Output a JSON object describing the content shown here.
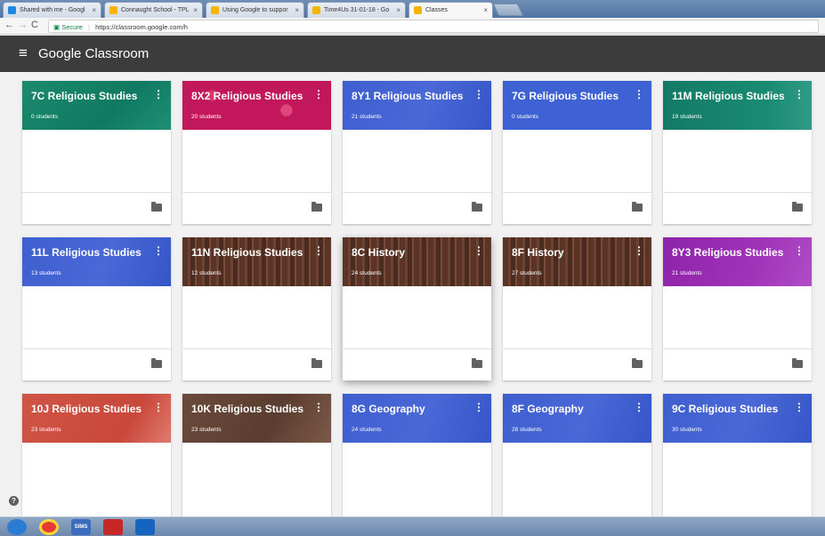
{
  "browser": {
    "tabs": [
      {
        "label": "Shared with me - Googl",
        "color": "#1e88e5"
      },
      {
        "label": "Connaught School - TPL",
        "color": "#f4b400"
      },
      {
        "label": "Using Google to suppor",
        "color": "#f4b400"
      },
      {
        "label": "Time4Us 31-01-18 - Go",
        "color": "#f4b400"
      },
      {
        "label": "Classes",
        "color": "#f4b400"
      }
    ],
    "secure_label": "Secure",
    "url": "https://classroom.google.com/h"
  },
  "app": {
    "brand": "Google",
    "name": "Classroom"
  },
  "classes": [
    {
      "title": "7C Religious Studies",
      "students": "0 students",
      "theme": "bg-teal"
    },
    {
      "title": "8X2 Religious Studies",
      "students": "20 students",
      "theme": "bg-pink"
    },
    {
      "title": "8Y1 Religious Studies",
      "students": "21 students",
      "theme": "bg-blue"
    },
    {
      "title": "7G Religious Studies",
      "students": "0 students",
      "theme": "bg-blue2"
    },
    {
      "title": "11M Religious Studies",
      "students": "19 students",
      "theme": "bg-teal2"
    },
    {
      "title": "11L Religious Studies",
      "students": "13 students",
      "theme": "bg-blue"
    },
    {
      "title": "11N Religious Studies",
      "students": "12 students",
      "theme": "bg-brown"
    },
    {
      "title": "8C History",
      "students": "24 students",
      "theme": "bg-brown"
    },
    {
      "title": "8F History",
      "students": "27 students",
      "theme": "bg-brown"
    },
    {
      "title": "8Y3 Religious Studies",
      "students": "21 students",
      "theme": "bg-purple"
    },
    {
      "title": "10J Religious Studies",
      "students": "23 students",
      "theme": "bg-red"
    },
    {
      "title": "10K Religious Studies",
      "students": "23 students",
      "theme": "bg-brown2"
    },
    {
      "title": "8G Geography",
      "students": "24 students",
      "theme": "bg-blue"
    },
    {
      "title": "8F Geography",
      "students": "28 students",
      "theme": "bg-blue"
    },
    {
      "title": "9C Religious Studies",
      "students": "30 students",
      "theme": "bg-blue"
    }
  ],
  "help_icon": "?",
  "taskbar": {
    "items": [
      {
        "icon": "windows-start-icon",
        "color": "#2b7cd3"
      },
      {
        "icon": "chrome-icon",
        "color": "#e53935"
      },
      {
        "icon": "sims-icon",
        "label": "SIMS",
        "color": "#3a6cc1"
      },
      {
        "icon": "acrobat-icon",
        "color": "#c62828"
      },
      {
        "icon": "outlook-icon",
        "color": "#1565c0"
      }
    ]
  }
}
